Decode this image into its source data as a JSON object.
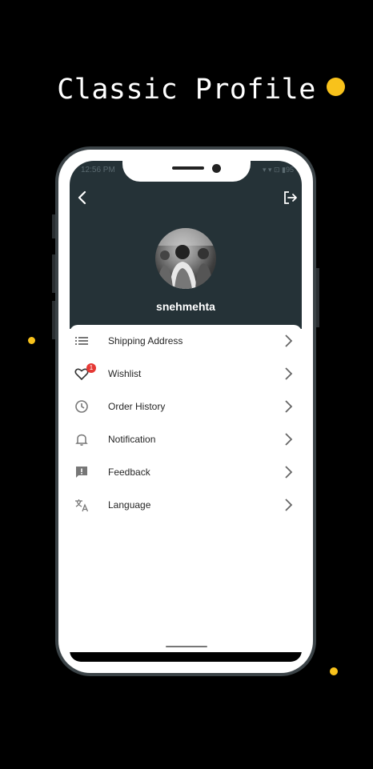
{
  "promo": {
    "title": "Classic Profile"
  },
  "status_bar": {
    "time": "12:56 PM",
    "icons": "▾ ▾ ⊡ ▮95"
  },
  "profile": {
    "username": "snehmehta"
  },
  "menu": {
    "items": [
      {
        "label": "Shipping Address",
        "icon": "list-icon"
      },
      {
        "label": "Wishlist",
        "icon": "heart-icon",
        "badge": "1"
      },
      {
        "label": "Order History",
        "icon": "clock-icon"
      },
      {
        "label": "Notification",
        "icon": "bell-icon"
      },
      {
        "label": "Feedback",
        "icon": "feedback-icon"
      },
      {
        "label": "Language",
        "icon": "translate-icon"
      }
    ]
  },
  "colors": {
    "header": "#253237",
    "accent_dot": "#f8c21b",
    "badge": "#e53935"
  }
}
